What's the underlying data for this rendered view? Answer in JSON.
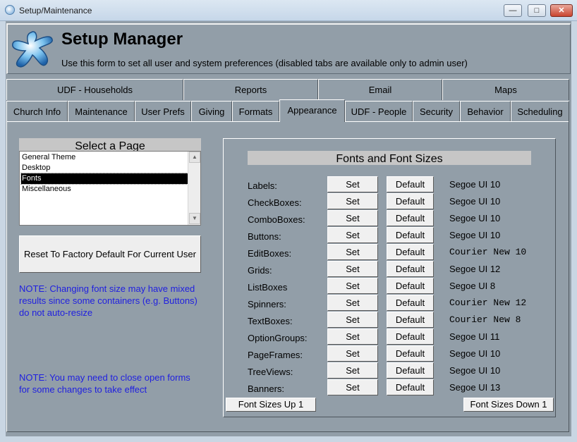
{
  "window": {
    "title": "Setup/Maintenance",
    "controls": [
      "minimize",
      "maximize",
      "close"
    ]
  },
  "header": {
    "title": "Setup Manager",
    "subtitle": "Use this form to set all user and system preferences (disabled tabs are available only to admin user)",
    "logo_icon": "star-figure-logo"
  },
  "tabs_row1": [
    "UDF - Households",
    "Reports",
    "Email",
    "Maps"
  ],
  "tabs_row2": [
    "Church Info",
    "Maintenance",
    "User Prefs",
    "Giving",
    "Formats",
    "Appearance",
    "UDF - People",
    "Security",
    "Behavior",
    "Scheduling"
  ],
  "active_tab": "Appearance",
  "select_page": {
    "caption": "Select a Page",
    "items": [
      "General Theme",
      "Desktop",
      "Fonts",
      "Miscellaneous"
    ],
    "selected": "Fonts"
  },
  "reset_button": "Reset To Factory Default For Current User",
  "note1": [
    "NOTE: Changing font size may have mixed",
    "results since some containers (e.g. Buttons)",
    "do not auto-resize"
  ],
  "note2": [
    "NOTE: You may need to close open forms",
    "for some changes to take effect"
  ],
  "fonts_panel": {
    "caption": "Fonts and Font Sizes",
    "set_label": "Set",
    "default_label": "Default",
    "rows": [
      {
        "label": "Labels:",
        "font": "Segoe UI 10",
        "mono": false
      },
      {
        "label": "CheckBoxes:",
        "font": "Segoe UI 10",
        "mono": false
      },
      {
        "label": "ComboBoxes:",
        "font": "Segoe UI 10",
        "mono": false
      },
      {
        "label": "Buttons:",
        "font": "Segoe UI 10",
        "mono": false
      },
      {
        "label": "EditBoxes:",
        "font": "Courier New 10",
        "mono": true
      },
      {
        "label": "Grids:",
        "font": "Segoe UI 12",
        "mono": false
      },
      {
        "label": "ListBoxes",
        "font": "Segoe UI 8",
        "mono": false
      },
      {
        "label": "Spinners:",
        "font": "Courier New 12",
        "mono": true
      },
      {
        "label": "TextBoxes:",
        "font": "Courier New 8",
        "mono": true
      },
      {
        "label": "OptionGroups:",
        "font": "Segoe UI 11",
        "mono": false
      },
      {
        "label": "PageFrames:",
        "font": "Segoe UI 10",
        "mono": false
      },
      {
        "label": "TreeViews:",
        "font": "Segoe UI 10",
        "mono": false
      },
      {
        "label": "Banners:",
        "font": "Segoe UI 13",
        "mono": false
      }
    ],
    "sizes_up": "Font Sizes Up 1",
    "sizes_down": "Font Sizes Down 1"
  },
  "colors": {
    "form_background": "#929ea8",
    "note_text": "#1f1fe0"
  }
}
